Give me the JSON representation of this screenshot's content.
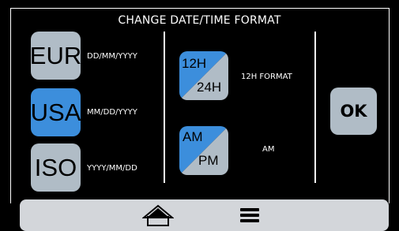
{
  "title": "CHANGE DATE/TIME FORMAT",
  "date_formats": [
    {
      "button": "EUR",
      "label": "DD/MM/YYYY",
      "selected": false
    },
    {
      "button": "USA",
      "label": "MM/DD/YYYY",
      "selected": true
    },
    {
      "button": "ISO",
      "label": "YYYY/MM/DD",
      "selected": false
    }
  ],
  "hour_format": {
    "top": "12H",
    "bottom": "24H",
    "selected": "12H",
    "status": "12H FORMAT"
  },
  "ampm": {
    "top": "AM",
    "bottom": "PM",
    "selected": "AM",
    "status": "AM"
  },
  "ok_label": "OK",
  "colors": {
    "selected": "#3c8edc",
    "unselected": "#b0bcc6",
    "navbar": "#d3d6da"
  },
  "nav": {
    "icons": [
      "home-icon",
      "menu-icon"
    ]
  }
}
